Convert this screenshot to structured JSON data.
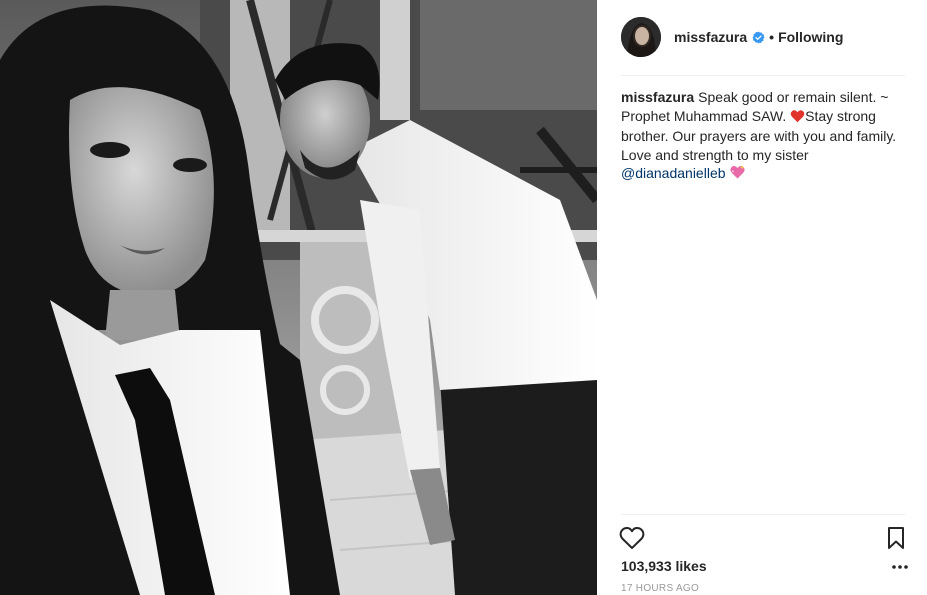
{
  "post": {
    "photo_icon": "selfie-photo",
    "author": {
      "username": "missfazura",
      "verified": true,
      "verified_icon": "verified-badge-icon",
      "verified_color": "#3897f0"
    },
    "separator_dot": "•",
    "follow_status": "Following",
    "caption": {
      "username": "missfazura",
      "text": "Speak good or remain silent. ~ Prophet Muhammad SAW. ",
      "emoji_1_icon": "red-heart-icon",
      "text_2": "Stay strong brother. Our prayers are with you and family. Love and strength to my sister ",
      "mention": "@dianadanielleb",
      "emoji_2_icon": "sparkling-heart-icon"
    },
    "actions": {
      "like_icon": "heart-outline-icon",
      "save_icon": "bookmark-icon",
      "more_icon": "more-options-icon"
    },
    "likes": "103,933 likes",
    "timestamp": "17 HOURS AGO"
  },
  "colors": {
    "text": "#262626",
    "link": "#003569",
    "muted": "#999999",
    "divider": "#efefef"
  }
}
